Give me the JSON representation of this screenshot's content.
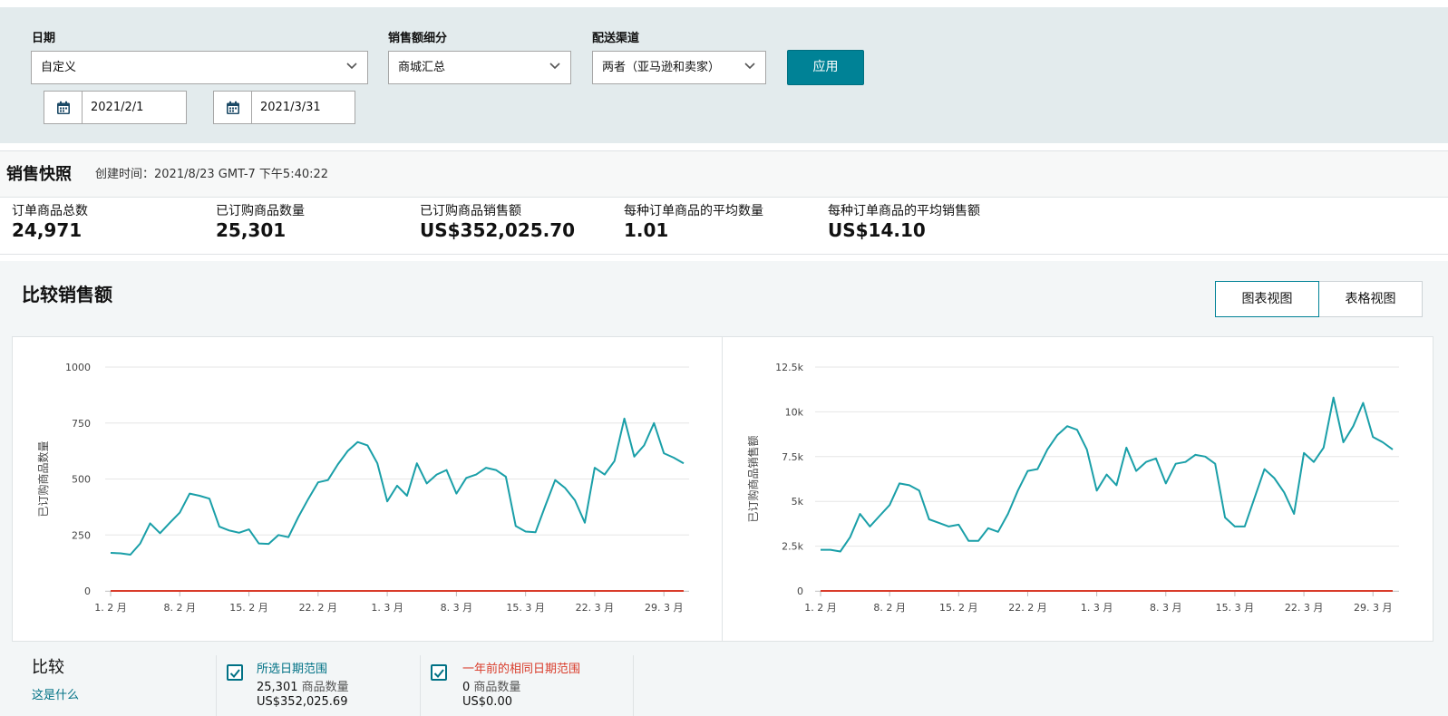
{
  "filters": {
    "date": {
      "label": "日期",
      "value": "自定义"
    },
    "start_date": "2021/2/1",
    "end_date": "2021/3/31",
    "breakdown": {
      "label": "销售额细分",
      "value": "商城汇总"
    },
    "channel": {
      "label": "配送渠道",
      "value": "两者（亚马逊和卖家）"
    },
    "apply_label": "应用"
  },
  "snapshot": {
    "title": "销售快照",
    "created": "创建时间：2021/8/23 GMT-7 下午5:40:22",
    "metrics": [
      {
        "label": "订单商品总数",
        "value": "24,971"
      },
      {
        "label": "已订购商品数量",
        "value": "25,301"
      },
      {
        "label": "已订购商品销售额",
        "value": "US$352,025.70"
      },
      {
        "label": "每种订单商品的平均数量",
        "value": "1.01"
      },
      {
        "label": "每种订单商品的平均销售额",
        "value": "US$14.10"
      }
    ]
  },
  "compare": {
    "title": "比较销售额",
    "views": [
      "图表视图",
      "表格视图"
    ],
    "legend_title": "比较",
    "whats_this": "这是什么",
    "series_a": {
      "title": "所选日期范围",
      "count": "25,301",
      "count_unit": "商品数量",
      "amount": "US$352,025.69"
    },
    "series_b": {
      "title": "一年前的相同日期范围",
      "count": "0",
      "count_unit": "商品数量",
      "amount": "US$0.00"
    }
  },
  "colors": {
    "accent": "#008296",
    "series_current": "#1a9fa8",
    "series_prior": "#d93c2b",
    "link": "#007185"
  },
  "chart_data": [
    {
      "type": "line",
      "ylabel": "已订购商品数量",
      "x_ticks": [
        "1. 2 月",
        "8. 2 月",
        "15. 2 月",
        "22. 2 月",
        "1. 3 月",
        "8. 3 月",
        "15. 3 月",
        "22. 3 月",
        "29. 3 月"
      ],
      "y_ticks": [
        "0",
        "250",
        "500",
        "750",
        "1000"
      ],
      "ylim": [
        0,
        1000
      ],
      "grid": true,
      "series": [
        {
          "name": "所选日期范围",
          "color": "#1a9fa8",
          "values": [
            170,
            168,
            162,
            212,
            302,
            258,
            305,
            350,
            435,
            425,
            412,
            287,
            270,
            260,
            275,
            212,
            210,
            250,
            240,
            330,
            410,
            485,
            495,
            565,
            625,
            665,
            650,
            570,
            400,
            470,
            425,
            570,
            480,
            520,
            540,
            435,
            505,
            520,
            550,
            540,
            510,
            290,
            265,
            262,
            380,
            495,
            460,
            405,
            305,
            550,
            520,
            580,
            770,
            600,
            650,
            750,
            615,
            595,
            570
          ]
        },
        {
          "name": "一年前的相同日期范围",
          "color": "#d93c2b",
          "values": [
            0,
            0,
            0,
            0,
            0,
            0,
            0,
            0,
            0,
            0,
            0,
            0,
            0,
            0,
            0,
            0,
            0,
            0,
            0,
            0,
            0,
            0,
            0,
            0,
            0,
            0,
            0,
            0,
            0,
            0,
            0,
            0,
            0,
            0,
            0,
            0,
            0,
            0,
            0,
            0,
            0,
            0,
            0,
            0,
            0,
            0,
            0,
            0,
            0,
            0,
            0,
            0,
            0,
            0,
            0,
            0,
            0,
            0,
            0
          ]
        }
      ]
    },
    {
      "type": "line",
      "ylabel": "已订购商品销售额",
      "x_ticks": [
        "1. 2 月",
        "8. 2 月",
        "15. 2 月",
        "22. 2 月",
        "1. 3 月",
        "8. 3 月",
        "15. 3 月",
        "22. 3 月",
        "29. 3 月"
      ],
      "y_ticks": [
        "0",
        "2.5k",
        "5k",
        "7.5k",
        "10k",
        "12.5k"
      ],
      "ylim": [
        0,
        12500
      ],
      "grid": true,
      "series": [
        {
          "name": "所选日期范围",
          "color": "#1a9fa8",
          "values": [
            2300,
            2300,
            2200,
            3000,
            4300,
            3600,
            4200,
            4800,
            6000,
            5900,
            5600,
            4000,
            3800,
            3600,
            3700,
            2800,
            2800,
            3500,
            3300,
            4300,
            5600,
            6700,
            6800,
            7900,
            8700,
            9200,
            9000,
            7900,
            5600,
            6500,
            5900,
            8000,
            6700,
            7200,
            7400,
            6000,
            7100,
            7200,
            7600,
            7500,
            7100,
            4100,
            3600,
            3600,
            5200,
            6800,
            6300,
            5500,
            4300,
            7700,
            7200,
            8000,
            10800,
            8300,
            9200,
            10500,
            8600,
            8300,
            7900
          ]
        },
        {
          "name": "一年前的相同日期范围",
          "color": "#d93c2b",
          "values": [
            0,
            0,
            0,
            0,
            0,
            0,
            0,
            0,
            0,
            0,
            0,
            0,
            0,
            0,
            0,
            0,
            0,
            0,
            0,
            0,
            0,
            0,
            0,
            0,
            0,
            0,
            0,
            0,
            0,
            0,
            0,
            0,
            0,
            0,
            0,
            0,
            0,
            0,
            0,
            0,
            0,
            0,
            0,
            0,
            0,
            0,
            0,
            0,
            0,
            0,
            0,
            0,
            0,
            0,
            0,
            0,
            0,
            0,
            0
          ]
        }
      ]
    }
  ]
}
